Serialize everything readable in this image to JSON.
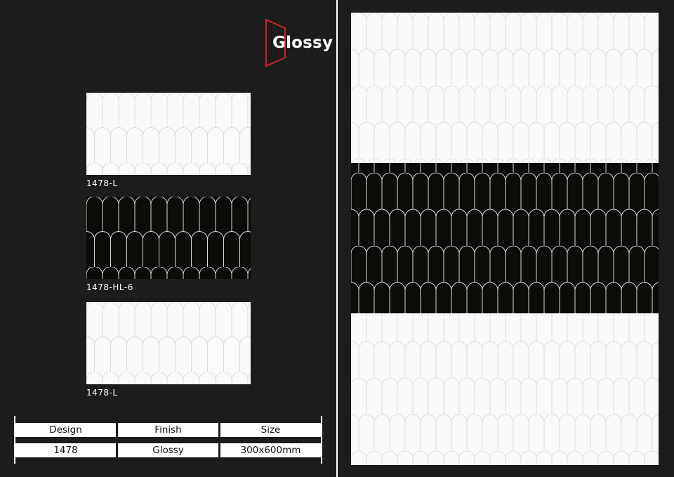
{
  "brand": {
    "finish_logo_text": "Glossy",
    "accent_color": "#c8242b"
  },
  "tiles": [
    {
      "code": "1478-L",
      "style": "white"
    },
    {
      "code": "1478-HL-6",
      "style": "black"
    },
    {
      "code": "1478-L",
      "style": "white"
    }
  ],
  "spec_table": {
    "headers": [
      "Design",
      "Finish",
      "Size"
    ],
    "values": [
      "1478",
      "Glossy",
      "300x600mm"
    ]
  }
}
